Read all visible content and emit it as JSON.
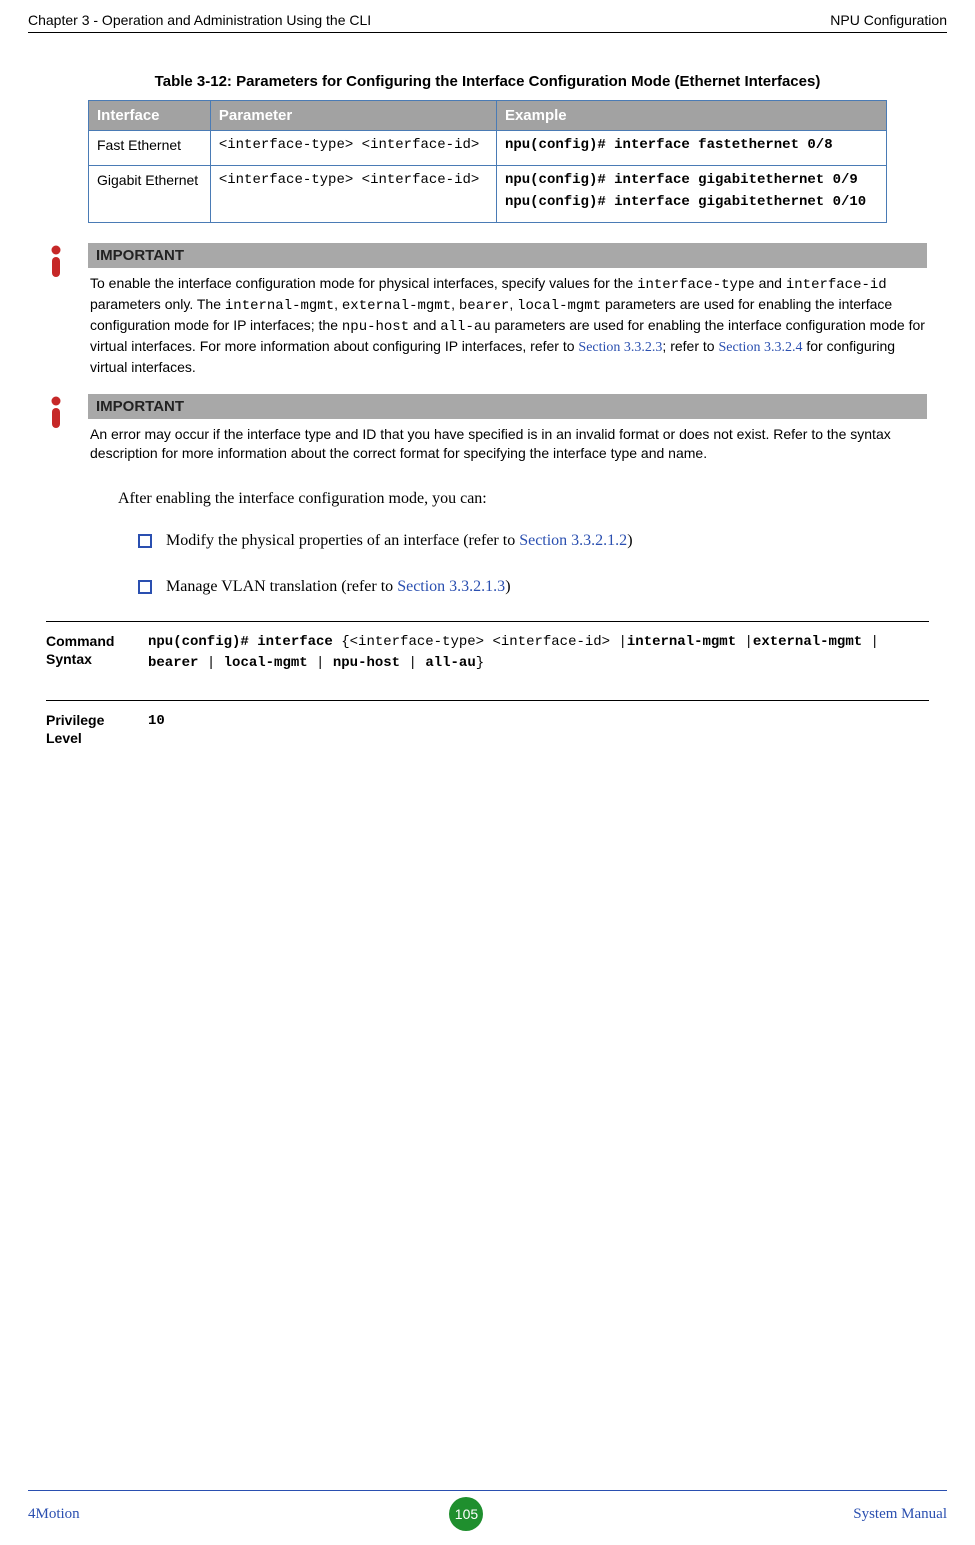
{
  "header": {
    "left": "Chapter 3 - Operation and Administration Using the CLI",
    "right": "NPU Configuration"
  },
  "table": {
    "caption": "Table 3-12: Parameters for Configuring the Interface Configuration Mode (Ethernet Interfaces)",
    "headers": [
      "Interface",
      "Parameter",
      "Example"
    ],
    "rows": [
      {
        "interface": "Fast Ethernet",
        "parameter": "<interface-type> <interface-id>",
        "example": [
          "npu(config)# interface fastethernet 0/8"
        ]
      },
      {
        "interface": "Gigabit Ethernet",
        "parameter": "<interface-type> <interface-id>",
        "example": [
          "npu(config)# interface gigabitethernet 0/9",
          "npu(config)# interface gigabitethernet 0/10"
        ]
      }
    ]
  },
  "callouts": [
    {
      "title": "IMPORTANT",
      "text_parts": [
        {
          "t": "plain",
          "v": "To enable the interface configuration mode for physical interfaces, specify values for the "
        },
        {
          "t": "mono",
          "v": "interface-type"
        },
        {
          "t": "plain",
          "v": " and "
        },
        {
          "t": "mono",
          "v": "interface-id"
        },
        {
          "t": "plain",
          "v": " parameters only. The "
        },
        {
          "t": "mono",
          "v": "internal-mgmt"
        },
        {
          "t": "plain",
          "v": ", "
        },
        {
          "t": "mono",
          "v": "external-mgmt"
        },
        {
          "t": "plain",
          "v": ", "
        },
        {
          "t": "mono",
          "v": "bearer"
        },
        {
          "t": "plain",
          "v": ", "
        },
        {
          "t": "mono",
          "v": "local-mgmt"
        },
        {
          "t": "plain",
          "v": " parameters are used for enabling the interface configuration mode for IP interfaces; the "
        },
        {
          "t": "mono",
          "v": "npu-host"
        },
        {
          "t": "plain",
          "v": " and "
        },
        {
          "t": "mono",
          "v": "all-au"
        },
        {
          "t": "plain",
          "v": " parameters are used for enabling the interface configuration mode for virtual interfaces. For more information about configuring IP interfaces, refer to "
        },
        {
          "t": "link",
          "v": "Section 3.3.2.3"
        },
        {
          "t": "plain",
          "v": "; refer to "
        },
        {
          "t": "link",
          "v": "Section 3.3.2.4"
        },
        {
          "t": "plain",
          "v": " for configuring virtual interfaces."
        }
      ]
    },
    {
      "title": "IMPORTANT",
      "text_parts": [
        {
          "t": "plain",
          "v": "An error may occur if the interface type and ID that you have specified is in an invalid format or does not exist. Refer to the syntax description for more information about the correct format for specifying the interface type and name."
        }
      ]
    }
  ],
  "body_paragraph": "After enabling the interface configuration mode, you can:",
  "bullets": [
    {
      "pre": "Modify the physical properties of an interface (refer to ",
      "link": "Section 3.3.2.1.2",
      "post": ")"
    },
    {
      "pre": "Manage VLAN translation (refer to ",
      "link": "Section 3.3.2.1.3",
      "post": ")"
    }
  ],
  "command": {
    "label": "Command Syntax",
    "parts": [
      {
        "t": "bold",
        "v": "npu(config)# interface "
      },
      {
        "t": "plain",
        "v": "{<interface-type> <interface-id> |"
      },
      {
        "t": "bold",
        "v": "internal-mgmt"
      },
      {
        "t": "plain",
        "v": " |"
      },
      {
        "t": "bold",
        "v": "external-mgmt"
      },
      {
        "t": "plain",
        "v": " | "
      },
      {
        "t": "bold",
        "v": "bearer"
      },
      {
        "t": "plain",
        "v": " | "
      },
      {
        "t": "bold",
        "v": "local-mgmt"
      },
      {
        "t": "plain",
        "v": " | "
      },
      {
        "t": "bold",
        "v": "npu-host"
      },
      {
        "t": "plain",
        "v": " | "
      },
      {
        "t": "bold",
        "v": "all-au"
      },
      {
        "t": "plain",
        "v": "}"
      }
    ]
  },
  "privilege": {
    "label": "Privilege Level",
    "value": "10"
  },
  "footer": {
    "left": "4Motion",
    "page": "105",
    "right": "System Manual"
  }
}
